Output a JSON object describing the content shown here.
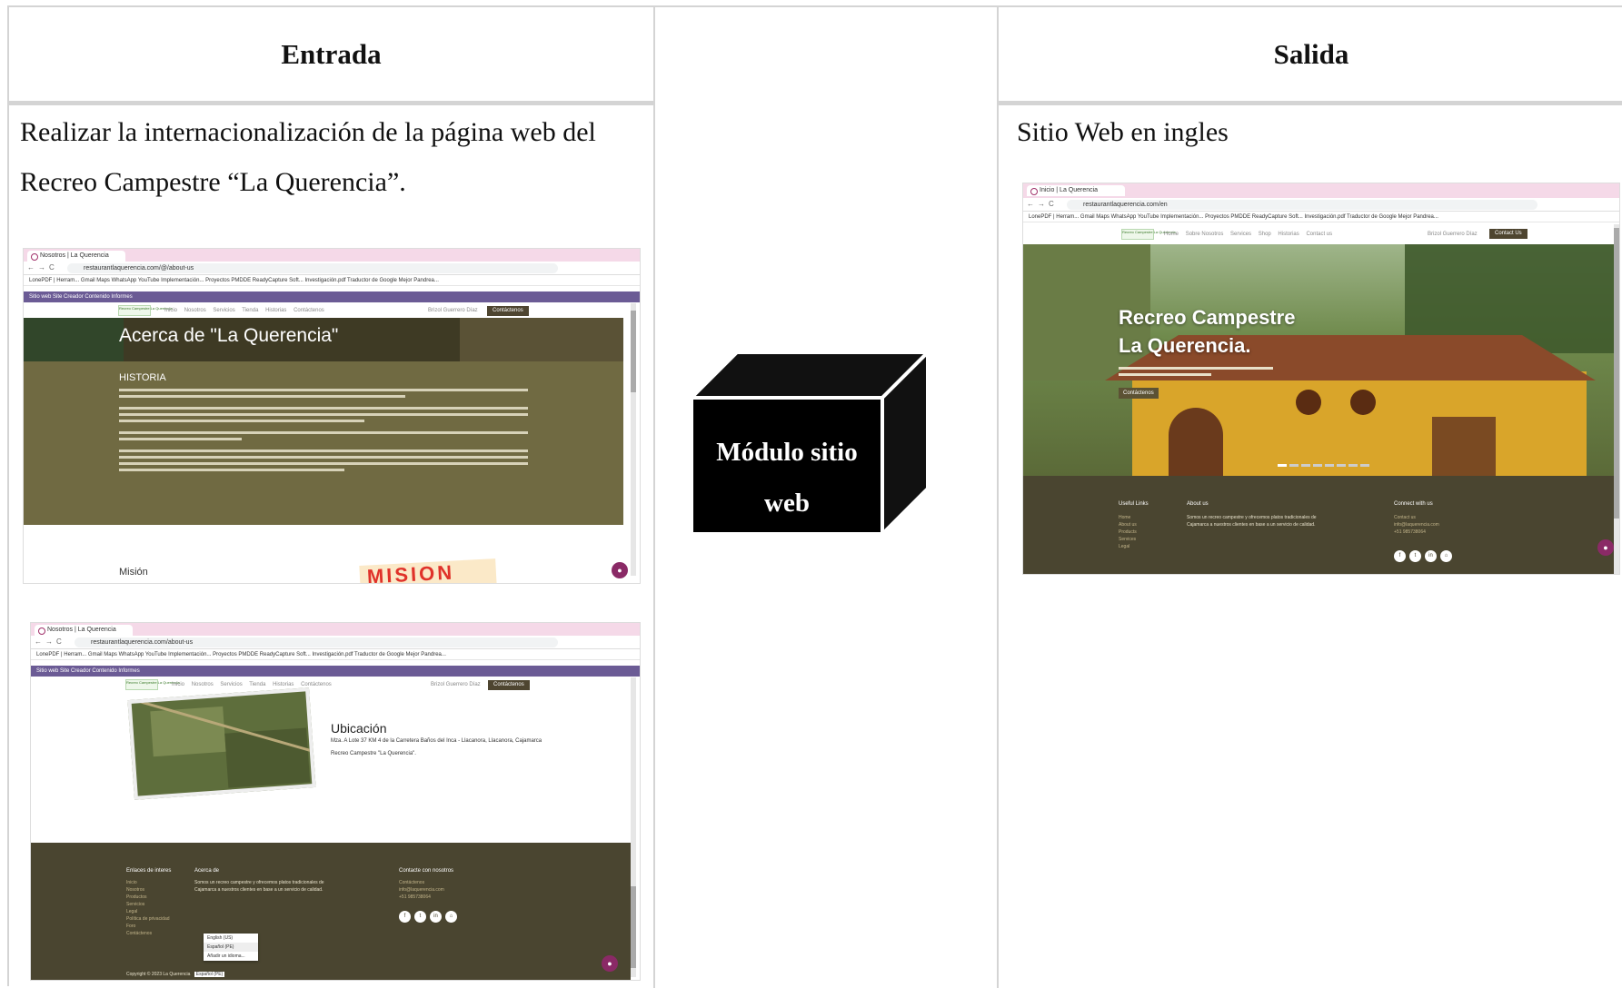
{
  "table": {
    "header_input": "Entrada",
    "header_output": "Salida",
    "input_text_line1": "Realizar la internacionalización de la página web del",
    "input_text_line2": "Recreo Campestre “La Querencia”.",
    "output_text": "Sitio Web en ingles",
    "module_label_line1": "Módulo sitio",
    "module_label_line2": "web"
  },
  "shot1": {
    "tab_title": "Nosotros | La Querencia",
    "url": "restaurantlaquerencia.com/@/about-us",
    "bookmarks": "LonePDF | Herram...   Gmail   Maps   WhatsApp   YouTube   Implementación...   Proyectos PMDDE   ReadyCapture Soft...   Investigación.pdf   Traductor de Google   Mejor Pandrea...",
    "odoo_bar": "Sitio web   Site   Creador Contenido   Informes",
    "nav_links": [
      "Inicio",
      "Nosotros",
      "Servicios",
      "Tienda",
      "Historias",
      "Contáctenos"
    ],
    "user": "Brizol Guerrero Díaz",
    "contact_btn": "Contáctenos",
    "hero_title": "Acerca de \"La Querencia\"",
    "section_title": "HISTORIA",
    "mission_label": "Misión",
    "mission_art": "MISION"
  },
  "shot2": {
    "tab_title": "Nosotros | La Querencia",
    "url": "restaurantlaquerencia.com/about-us",
    "bookmarks": "LonePDF | Herram...   Gmail   Maps   WhatsApp   YouTube   Implementación...   Proyectos PMDDE   ReadyCapture Soft...   Investigación.pdf   Traductor de Google   Mejor Pandrea...",
    "odoo_bar": "Sitio web   Site   Creador Contenido   Informes",
    "nav_links": [
      "Inicio",
      "Nosotros",
      "Servicios",
      "Tienda",
      "Historias",
      "Contáctenos"
    ],
    "user": "Brizol Guerrero Díaz",
    "contact_btn": "Contáctenos",
    "location_title": "Ubicación",
    "location_line1": "Mza. A Lote 37 KM 4 de la Carretera Baños del Inca - Llacanora, Llacanora, Cajamarca",
    "location_line2": "Recreo Campestre \"La Querencia\".",
    "footer_links_title": "Enlaces de interes",
    "footer_links": [
      "Inicio",
      "Nosotros",
      "Productos",
      "Servicios",
      "Legal",
      "Política de privacidad",
      "Foro",
      "Contáctenos"
    ],
    "footer_about_title": "Acerca de",
    "footer_about_text": "Somos un recreo campestre y ofrecemos platos tradicionales de Cajamarca a nuestros clientes en base a un servicio de calidad.",
    "footer_contact_title": "Contacte con nosotros",
    "footer_contact": [
      "Contáctenos",
      "info@laquerencia.com",
      "+51 985738064"
    ],
    "lang_options": [
      "English (US)",
      "Español (PE)",
      "Añadir un idioma..."
    ],
    "copyright": "Copyright © 2023 La Querencia",
    "lang_current": "Español (PE)"
  },
  "shot3": {
    "tab_title": "Inicio | La Querencia",
    "url": "restaurantlaquerencia.com/en",
    "bookmarks": "LonePDF | Herram...   Gmail   Maps   WhatsApp   YouTube   Implementación...   Proyectos PMDDE   ReadyCapture Soft...   Investigación.pdf   Traductor de Google   Mejor Pandrea...",
    "nav_links": [
      "Home",
      "Sobre Nosotros",
      "Services",
      "Shop",
      "Historias",
      "Contact us"
    ],
    "user": "Brizol Guerrero Díaz",
    "contact_btn": "Contact Us",
    "hero_line1": "Recreo Campestre",
    "hero_line2": "La Querencia.",
    "hero_btn": "Contáctenos",
    "footer_links_title": "Useful Links",
    "footer_links": [
      "Home",
      "About us",
      "Products",
      "Services",
      "Legal"
    ],
    "footer_about_title": "About us",
    "footer_about_text": "Somos un recreo campestre y ofrecemos platos tradicionales de Cajamarca a nuestros clientes en base a un servicio de calidad.",
    "footer_contact_title": "Connect with us",
    "footer_contact": [
      "Contact us",
      "info@laquerencia.com",
      "+51 985738064"
    ]
  },
  "colors": {
    "olive": "#706a42",
    "dark_olive": "#4a4530",
    "tab_pink": "#f5d9e8",
    "odoo_purple": "#6b5b95",
    "chat_fab": "#8a2a66",
    "border": "#d4d4d4"
  },
  "icons": [
    "chevron-icon",
    "star-icon",
    "chat-icon",
    "facebook-icon",
    "twitter-icon",
    "linkedin-icon",
    "home-icon"
  ]
}
